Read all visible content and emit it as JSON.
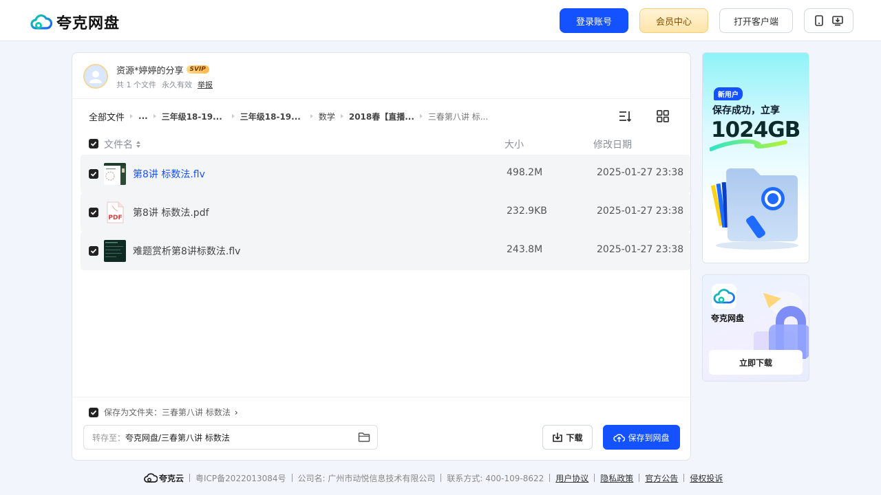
{
  "header": {
    "brand": "夸克网盘",
    "login": "登录账号",
    "vip": "会员中心",
    "client": "打开客户端"
  },
  "owner": {
    "name": "资源*婷婷的分享",
    "badge": "SVIP",
    "file_count": "共 1 个文件",
    "validity": "永久有效",
    "report": "举报"
  },
  "breadcrumb": [
    "全部文件",
    "...",
    "三年级18-19...",
    "三年级18-19...",
    "数学",
    "2018春【直播...",
    "三春第八讲 标..."
  ],
  "columns": {
    "name": "文件名",
    "size": "大小",
    "date": "修改日期"
  },
  "files": [
    {
      "name": "第8讲 标数法.flv",
      "size": "498.2M",
      "date": "2025-01-27 23:38",
      "type": "video"
    },
    {
      "name": "第8讲 标数法.pdf",
      "size": "232.9KB",
      "date": "2025-01-27 23:38",
      "type": "pdf"
    },
    {
      "name": "难题赏析第8讲标数法.flv",
      "size": "243.8M",
      "date": "2025-01-27 23:38",
      "type": "video"
    }
  ],
  "pdf_icon_label": "PDF",
  "save": {
    "folder_option": "保存为文件夹：三春第八讲 标数法",
    "arrow": "›",
    "path_label": "转存至：",
    "path_value": "夸克网盘/三春第八讲 标数法",
    "download": "下载",
    "save_button": "保存到网盘"
  },
  "ad1": {
    "badge": "新用户",
    "line1": "保存成功，立享",
    "big": "1024GB"
  },
  "ad2": {
    "name": "夸克网盘",
    "button": "立即下载"
  },
  "footer": {
    "brand": "夸克云",
    "icp": "粤ICP备2022013084号",
    "company": "公司名: 广州市动悦信息技术有限公司",
    "contact": "联系方式: 400-109-8622",
    "links": [
      "用户协议",
      "隐私政策",
      "官方公告",
      "侵权投诉"
    ]
  },
  "colors": {
    "accent": "#1552ff",
    "vip_gold": "#ffe5a8",
    "bg": "#f2f5fc"
  }
}
